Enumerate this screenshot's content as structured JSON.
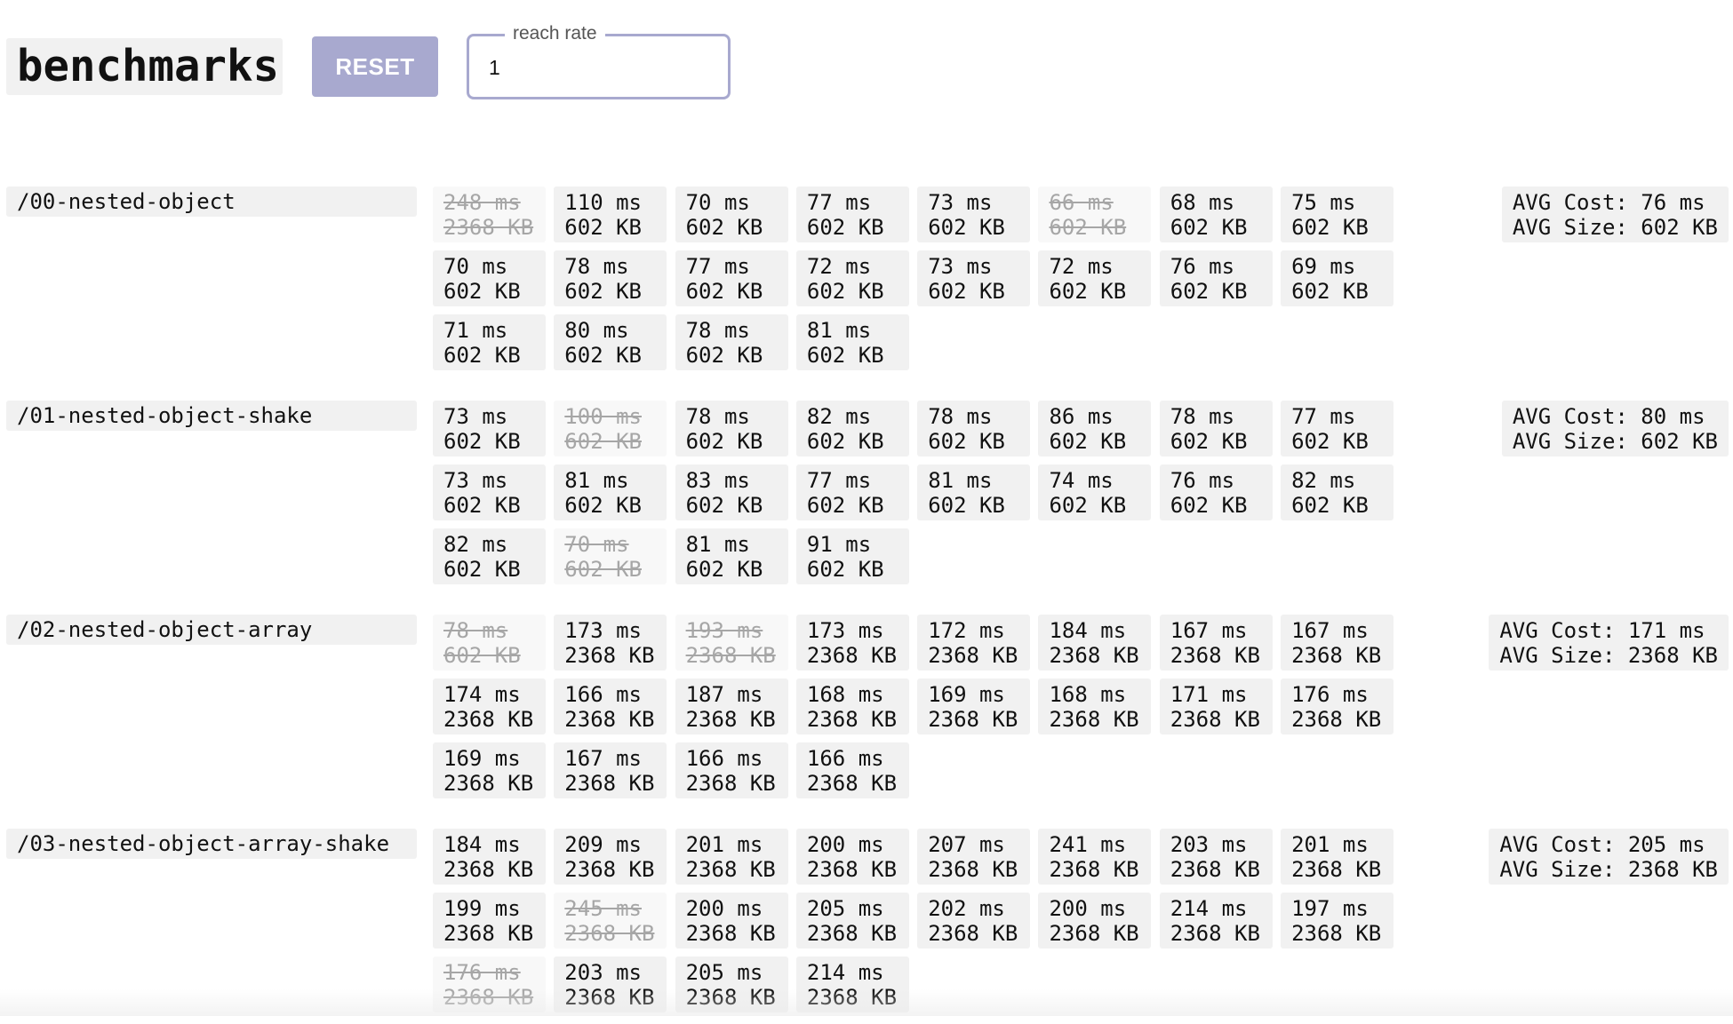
{
  "header": {
    "title": "benchmarks",
    "reset_label": "RESET",
    "reach_rate_label": "reach rate",
    "reach_rate_value": "1"
  },
  "benchmarks": [
    {
      "name": "/00-nested-object",
      "avg_cost": "AVG Cost: 76 ms",
      "avg_size": "AVG Size: 602 KB",
      "runs": [
        {
          "time": "248 ms",
          "size": "2368 KB",
          "excluded": true
        },
        {
          "time": "110 ms",
          "size": "602 KB",
          "excluded": false
        },
        {
          "time": "70 ms",
          "size": "602 KB",
          "excluded": false
        },
        {
          "time": "77 ms",
          "size": "602 KB",
          "excluded": false
        },
        {
          "time": "73 ms",
          "size": "602 KB",
          "excluded": false
        },
        {
          "time": "66 ms",
          "size": "602 KB",
          "excluded": true
        },
        {
          "time": "68 ms",
          "size": "602 KB",
          "excluded": false
        },
        {
          "time": "75 ms",
          "size": "602 KB",
          "excluded": false
        },
        {
          "time": "70 ms",
          "size": "602 KB",
          "excluded": false
        },
        {
          "time": "78 ms",
          "size": "602 KB",
          "excluded": false
        },
        {
          "time": "77 ms",
          "size": "602 KB",
          "excluded": false
        },
        {
          "time": "72 ms",
          "size": "602 KB",
          "excluded": false
        },
        {
          "time": "73 ms",
          "size": "602 KB",
          "excluded": false
        },
        {
          "time": "72 ms",
          "size": "602 KB",
          "excluded": false
        },
        {
          "time": "76 ms",
          "size": "602 KB",
          "excluded": false
        },
        {
          "time": "69 ms",
          "size": "602 KB",
          "excluded": false
        },
        {
          "time": "71 ms",
          "size": "602 KB",
          "excluded": false
        },
        {
          "time": "80 ms",
          "size": "602 KB",
          "excluded": false
        },
        {
          "time": "78 ms",
          "size": "602 KB",
          "excluded": false
        },
        {
          "time": "81 ms",
          "size": "602 KB",
          "excluded": false
        }
      ]
    },
    {
      "name": "/01-nested-object-shake",
      "avg_cost": "AVG Cost: 80 ms",
      "avg_size": "AVG Size: 602 KB",
      "runs": [
        {
          "time": "73 ms",
          "size": "602 KB",
          "excluded": false
        },
        {
          "time": "100 ms",
          "size": "602 KB",
          "excluded": true
        },
        {
          "time": "78 ms",
          "size": "602 KB",
          "excluded": false
        },
        {
          "time": "82 ms",
          "size": "602 KB",
          "excluded": false
        },
        {
          "time": "78 ms",
          "size": "602 KB",
          "excluded": false
        },
        {
          "time": "86 ms",
          "size": "602 KB",
          "excluded": false
        },
        {
          "time": "78 ms",
          "size": "602 KB",
          "excluded": false
        },
        {
          "time": "77 ms",
          "size": "602 KB",
          "excluded": false
        },
        {
          "time": "73 ms",
          "size": "602 KB",
          "excluded": false
        },
        {
          "time": "81 ms",
          "size": "602 KB",
          "excluded": false
        },
        {
          "time": "83 ms",
          "size": "602 KB",
          "excluded": false
        },
        {
          "time": "77 ms",
          "size": "602 KB",
          "excluded": false
        },
        {
          "time": "81 ms",
          "size": "602 KB",
          "excluded": false
        },
        {
          "time": "74 ms",
          "size": "602 KB",
          "excluded": false
        },
        {
          "time": "76 ms",
          "size": "602 KB",
          "excluded": false
        },
        {
          "time": "82 ms",
          "size": "602 KB",
          "excluded": false
        },
        {
          "time": "82 ms",
          "size": "602 KB",
          "excluded": false
        },
        {
          "time": "70 ms",
          "size": "602 KB",
          "excluded": true
        },
        {
          "time": "81 ms",
          "size": "602 KB",
          "excluded": false
        },
        {
          "time": "91 ms",
          "size": "602 KB",
          "excluded": false
        }
      ]
    },
    {
      "name": "/02-nested-object-array",
      "avg_cost": "AVG Cost: 171 ms",
      "avg_size": "AVG Size: 2368 KB",
      "runs": [
        {
          "time": "78 ms",
          "size": "602 KB",
          "excluded": true
        },
        {
          "time": "173 ms",
          "size": "2368 KB",
          "excluded": false
        },
        {
          "time": "193 ms",
          "size": "2368 KB",
          "excluded": true
        },
        {
          "time": "173 ms",
          "size": "2368 KB",
          "excluded": false
        },
        {
          "time": "172 ms",
          "size": "2368 KB",
          "excluded": false
        },
        {
          "time": "184 ms",
          "size": "2368 KB",
          "excluded": false
        },
        {
          "time": "167 ms",
          "size": "2368 KB",
          "excluded": false
        },
        {
          "time": "167 ms",
          "size": "2368 KB",
          "excluded": false
        },
        {
          "time": "174 ms",
          "size": "2368 KB",
          "excluded": false
        },
        {
          "time": "166 ms",
          "size": "2368 KB",
          "excluded": false
        },
        {
          "time": "187 ms",
          "size": "2368 KB",
          "excluded": false
        },
        {
          "time": "168 ms",
          "size": "2368 KB",
          "excluded": false
        },
        {
          "time": "169 ms",
          "size": "2368 KB",
          "excluded": false
        },
        {
          "time": "168 ms",
          "size": "2368 KB",
          "excluded": false
        },
        {
          "time": "171 ms",
          "size": "2368 KB",
          "excluded": false
        },
        {
          "time": "176 ms",
          "size": "2368 KB",
          "excluded": false
        },
        {
          "time": "169 ms",
          "size": "2368 KB",
          "excluded": false
        },
        {
          "time": "167 ms",
          "size": "2368 KB",
          "excluded": false
        },
        {
          "time": "166 ms",
          "size": "2368 KB",
          "excluded": false
        },
        {
          "time": "166 ms",
          "size": "2368 KB",
          "excluded": false
        }
      ]
    },
    {
      "name": "/03-nested-object-array-shake",
      "avg_cost": "AVG Cost: 205 ms",
      "avg_size": "AVG Size: 2368 KB",
      "runs": [
        {
          "time": "184 ms",
          "size": "2368 KB",
          "excluded": false
        },
        {
          "time": "209 ms",
          "size": "2368 KB",
          "excluded": false
        },
        {
          "time": "201 ms",
          "size": "2368 KB",
          "excluded": false
        },
        {
          "time": "200 ms",
          "size": "2368 KB",
          "excluded": false
        },
        {
          "time": "207 ms",
          "size": "2368 KB",
          "excluded": false
        },
        {
          "time": "241 ms",
          "size": "2368 KB",
          "excluded": false
        },
        {
          "time": "203 ms",
          "size": "2368 KB",
          "excluded": false
        },
        {
          "time": "201 ms",
          "size": "2368 KB",
          "excluded": false
        },
        {
          "time": "199 ms",
          "size": "2368 KB",
          "excluded": false
        },
        {
          "time": "245 ms",
          "size": "2368 KB",
          "excluded": true
        },
        {
          "time": "200 ms",
          "size": "2368 KB",
          "excluded": false
        },
        {
          "time": "205 ms",
          "size": "2368 KB",
          "excluded": false
        },
        {
          "time": "202 ms",
          "size": "2368 KB",
          "excluded": false
        },
        {
          "time": "200 ms",
          "size": "2368 KB",
          "excluded": false
        },
        {
          "time": "214 ms",
          "size": "2368 KB",
          "excluded": false
        },
        {
          "time": "197 ms",
          "size": "2368 KB",
          "excluded": false
        },
        {
          "time": "176 ms",
          "size": "2368 KB",
          "excluded": true
        },
        {
          "time": "203 ms",
          "size": "2368 KB",
          "excluded": false
        },
        {
          "time": "205 ms",
          "size": "2368 KB",
          "excluded": false
        },
        {
          "time": "214 ms",
          "size": "2368 KB",
          "excluded": false
        }
      ]
    }
  ]
}
